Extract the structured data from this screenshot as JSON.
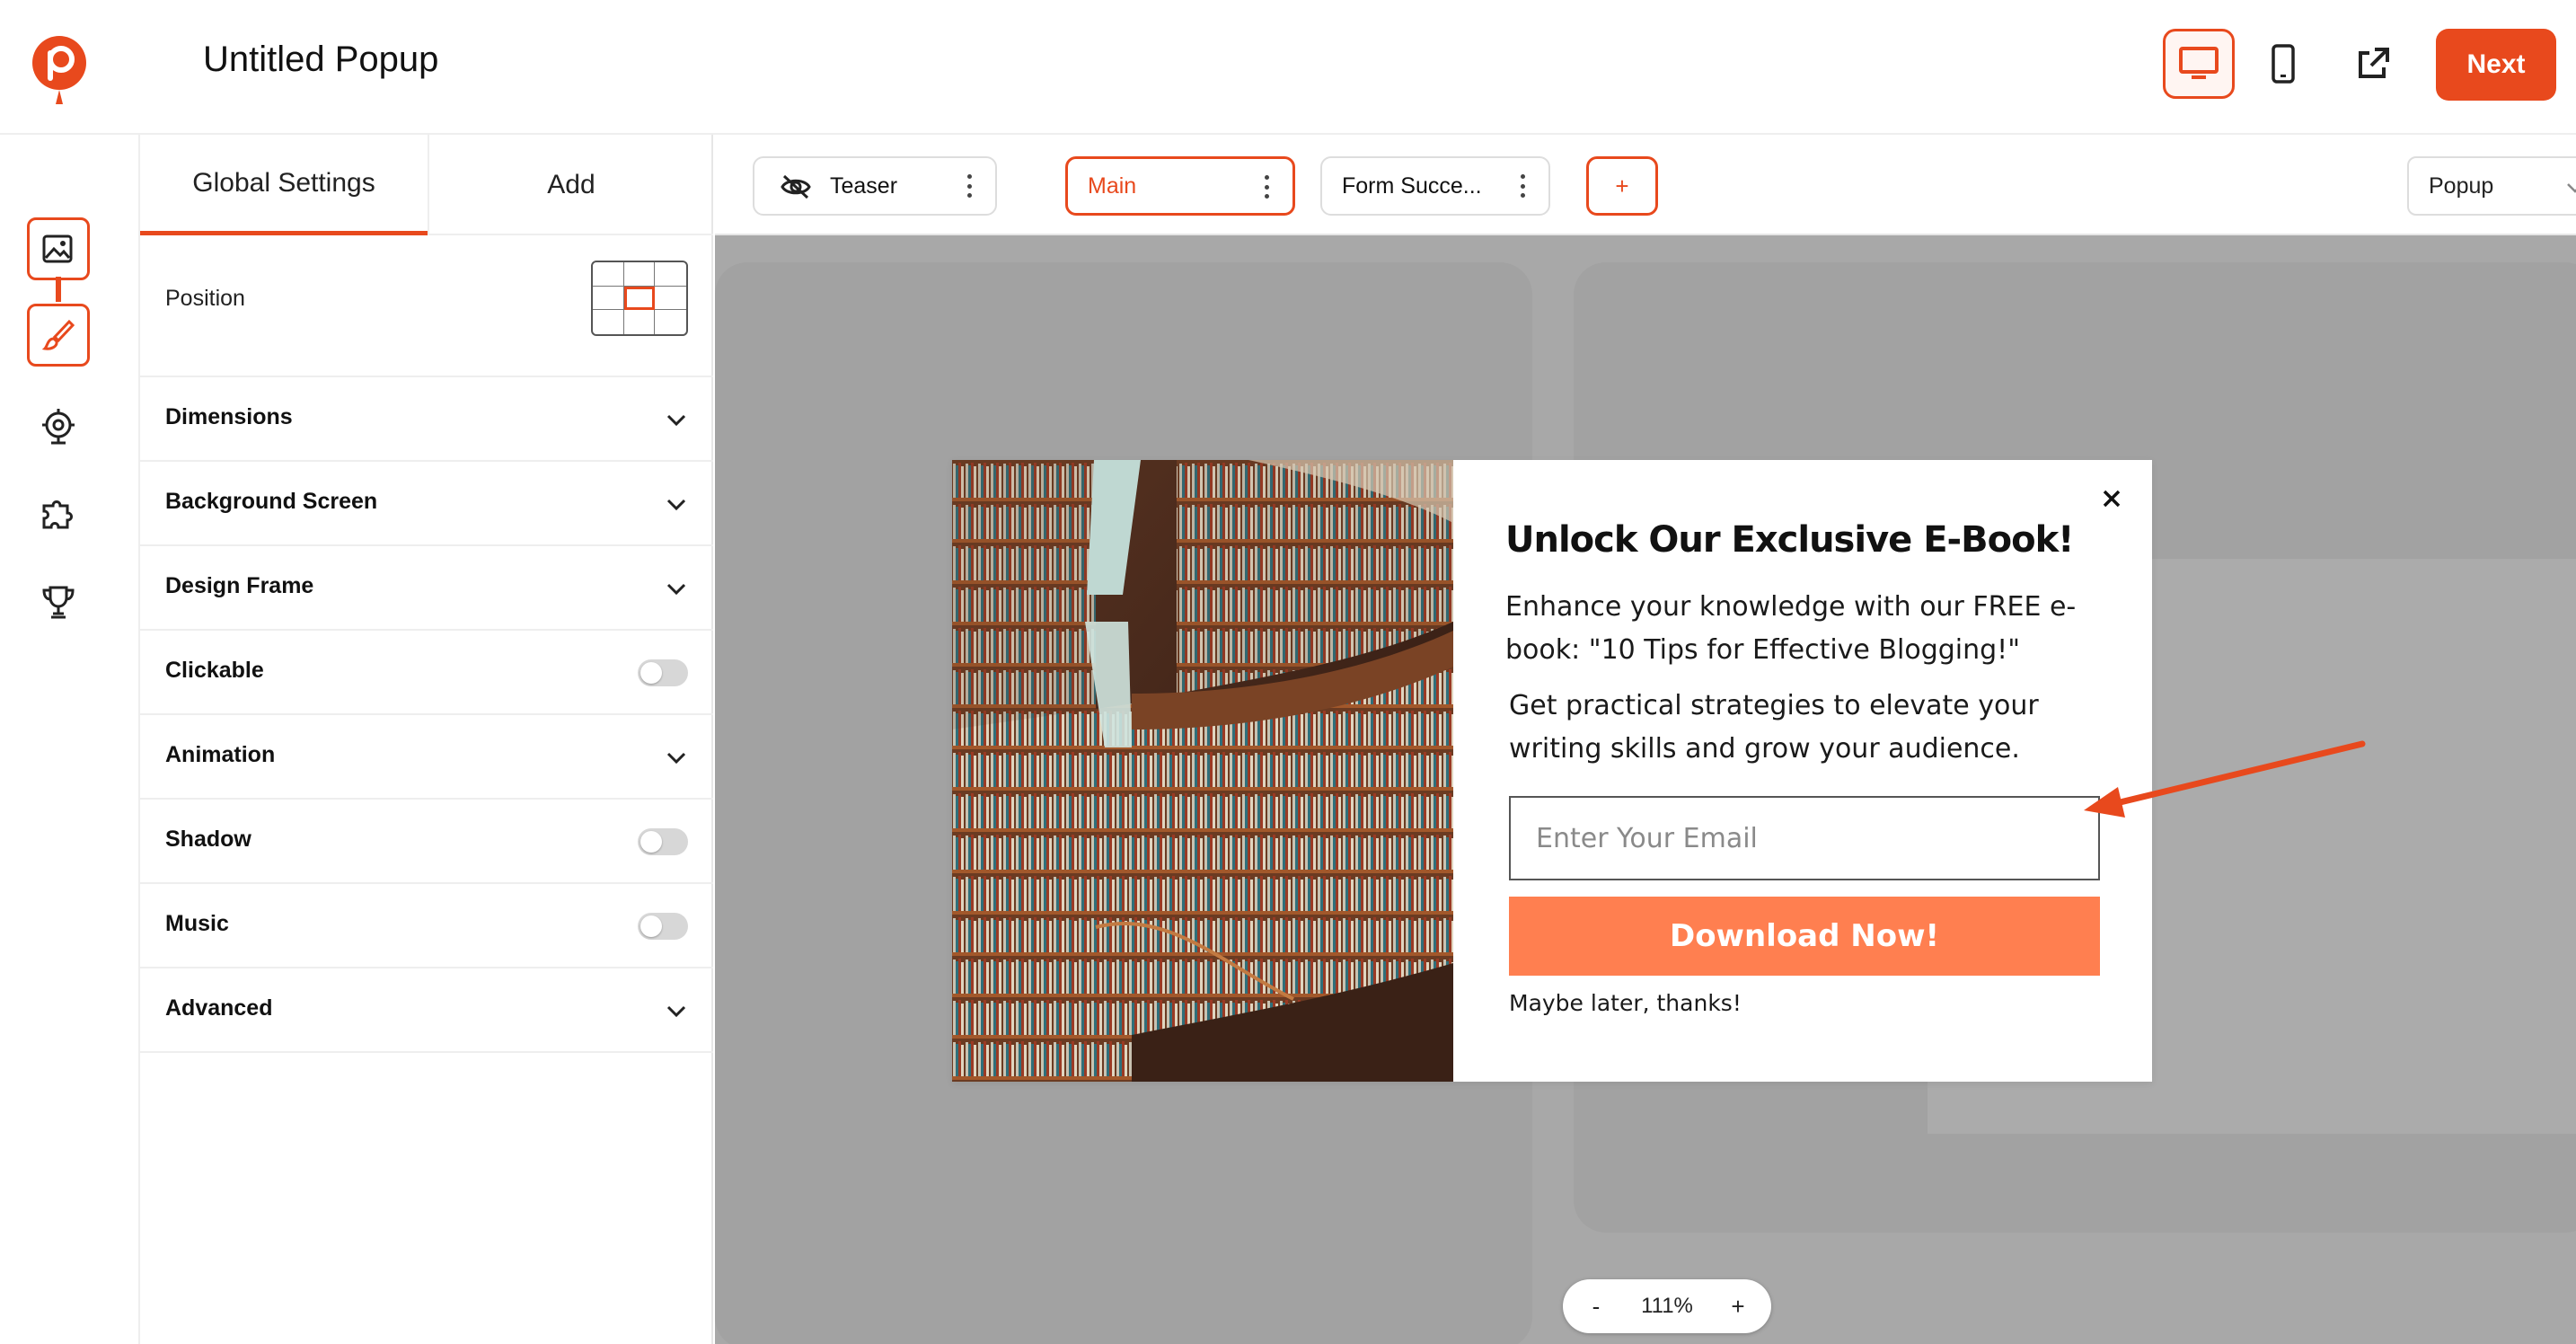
{
  "app": {
    "title": "Untitled Popup",
    "next_label": "Next",
    "accent_color": "#e8491d"
  },
  "header": {
    "icons": [
      "desktop-view-icon",
      "mobile-view-icon",
      "external-link-icon"
    ],
    "active_view": "desktop"
  },
  "rail": {
    "items": [
      "image-icon",
      "brush-icon",
      "target-icon",
      "puzzle-icon",
      "trophy-icon"
    ]
  },
  "panel": {
    "tabs": [
      {
        "label": "Global Settings",
        "active": true
      },
      {
        "label": "Add",
        "active": false
      }
    ],
    "position_label": "Position",
    "rows": [
      {
        "label": "Dimensions",
        "control": "chevron"
      },
      {
        "label": "Background Screen",
        "control": "chevron"
      },
      {
        "label": "Design Frame",
        "control": "chevron"
      },
      {
        "label": "Clickable",
        "control": "toggle",
        "on": false
      },
      {
        "label": "Animation",
        "control": "chevron"
      },
      {
        "label": "Shadow",
        "control": "toggle",
        "on": false
      },
      {
        "label": "Music",
        "control": "toggle",
        "on": false
      },
      {
        "label": "Advanced",
        "control": "chevron"
      }
    ]
  },
  "steps": {
    "tabs": [
      {
        "label": "Teaser",
        "icon": "eye-off-icon",
        "active": false
      },
      {
        "label": "Main",
        "active": true
      },
      {
        "label": "Form Succe...",
        "active": false
      }
    ],
    "add_label": "+",
    "type_select": "Popup"
  },
  "popup": {
    "title": "Unlock Our Exclusive E-Book!",
    "text1": "Enhance your knowledge with our FREE e-book: \"10 Tips for Effective Blogging!\"",
    "text2": "Get practical strategies to elevate your writing skills and grow your audience.",
    "email_placeholder": "Enter Your Email",
    "cta_label": "Download Now!",
    "cta_color": "#ff7f50",
    "decline_label": "Maybe later, thanks!",
    "image": "library-bookshelves"
  },
  "zoom": {
    "minus": "-",
    "value": "111%",
    "plus": "+"
  }
}
